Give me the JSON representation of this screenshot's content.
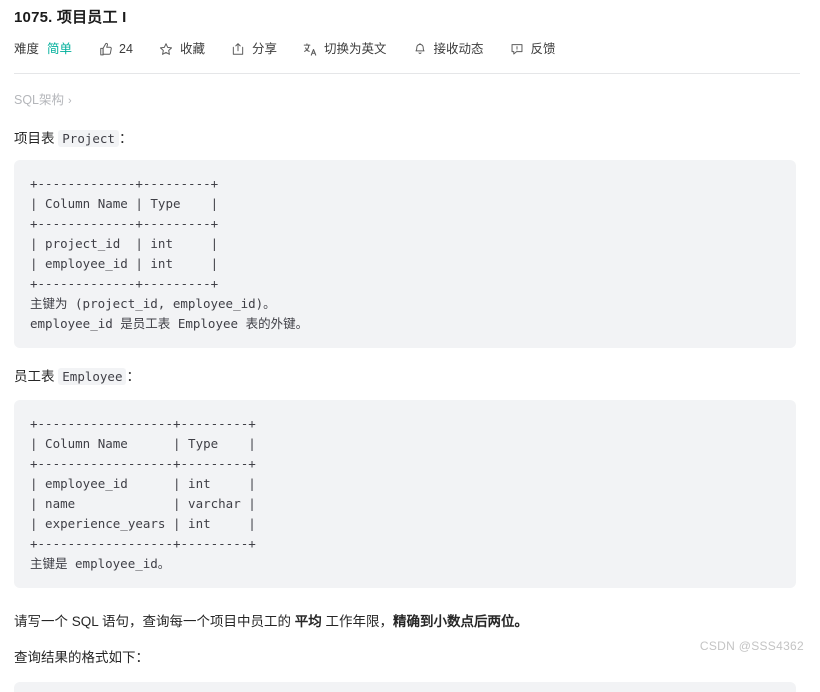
{
  "header": {
    "title": "1075. 项目员工 I",
    "toolbar": [
      {
        "name": "difficulty",
        "icon": "none",
        "label": "难度",
        "value": "简单"
      },
      {
        "name": "like",
        "icon": "thumbs-up-icon",
        "label": "24"
      },
      {
        "name": "favorite",
        "icon": "star-icon",
        "label": "收藏"
      },
      {
        "name": "share",
        "icon": "share-icon",
        "label": "分享"
      },
      {
        "name": "translate",
        "icon": "translate-icon",
        "label": "切换为英文"
      },
      {
        "name": "subscribe",
        "icon": "bell-icon",
        "label": "接收动态"
      },
      {
        "name": "feedback",
        "icon": "feedback-icon",
        "label": "反馈"
      }
    ]
  },
  "breadcrumb": {
    "label": "SQL架构",
    "chevron": "›"
  },
  "content": {
    "project_heading_prefix": "项目表 ",
    "project_heading_code": "Project",
    "project_heading_suffix": "：",
    "project_table": "+-------------+---------+\n| Column Name | Type    |\n+-------------+---------+\n| project_id  | int     |\n| employee_id | int     |\n+-------------+---------+\n主键为 (project_id, employee_id)。\nemployee_id 是员工表 Employee 表的外键。",
    "employee_heading_prefix": "员工表 ",
    "employee_heading_code": "Employee",
    "employee_heading_suffix": "：",
    "employee_table": "+------------------+---------+\n| Column Name      | Type    |\n+------------------+---------+\n| employee_id      | int     |\n| name             | varchar |\n| experience_years | int     |\n+------------------+---------+\n主键是 employee_id。",
    "question_part1": "请写一个 SQL 语句，查询每一个项目中员工的 ",
    "question_bold1": "平均",
    "question_part2": " 工作年限，",
    "question_bold2": "精确到小数点后两位。",
    "result_format_text": "查询结果的格式如下："
  },
  "watermark": "CSDN @SSS4362",
  "colors": {
    "easy": "#00af9b",
    "code_bg": "#f2f3f5",
    "text": "#262626",
    "muted": "#b4b6ba"
  }
}
